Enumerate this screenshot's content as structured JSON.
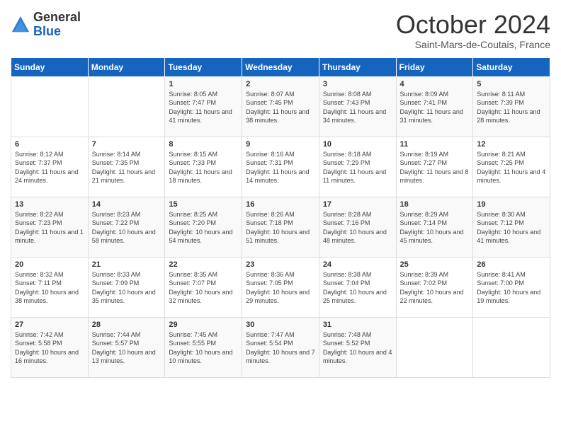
{
  "header": {
    "logo_general": "General",
    "logo_blue": "Blue",
    "month_title": "October 2024",
    "subtitle": "Saint-Mars-de-Coutais, France"
  },
  "days_of_week": [
    "Sunday",
    "Monday",
    "Tuesday",
    "Wednesday",
    "Thursday",
    "Friday",
    "Saturday"
  ],
  "weeks": [
    [
      {
        "day": "",
        "info": ""
      },
      {
        "day": "",
        "info": ""
      },
      {
        "day": "1",
        "info": "Sunrise: 8:05 AM\nSunset: 7:47 PM\nDaylight: 11 hours and 41 minutes."
      },
      {
        "day": "2",
        "info": "Sunrise: 8:07 AM\nSunset: 7:45 PM\nDaylight: 11 hours and 38 minutes."
      },
      {
        "day": "3",
        "info": "Sunrise: 8:08 AM\nSunset: 7:43 PM\nDaylight: 11 hours and 34 minutes."
      },
      {
        "day": "4",
        "info": "Sunrise: 8:09 AM\nSunset: 7:41 PM\nDaylight: 11 hours and 31 minutes."
      },
      {
        "day": "5",
        "info": "Sunrise: 8:11 AM\nSunset: 7:39 PM\nDaylight: 11 hours and 28 minutes."
      }
    ],
    [
      {
        "day": "6",
        "info": "Sunrise: 8:12 AM\nSunset: 7:37 PM\nDaylight: 11 hours and 24 minutes."
      },
      {
        "day": "7",
        "info": "Sunrise: 8:14 AM\nSunset: 7:35 PM\nDaylight: 11 hours and 21 minutes."
      },
      {
        "day": "8",
        "info": "Sunrise: 8:15 AM\nSunset: 7:33 PM\nDaylight: 11 hours and 18 minutes."
      },
      {
        "day": "9",
        "info": "Sunrise: 8:16 AM\nSunset: 7:31 PM\nDaylight: 11 hours and 14 minutes."
      },
      {
        "day": "10",
        "info": "Sunrise: 8:18 AM\nSunset: 7:29 PM\nDaylight: 11 hours and 11 minutes."
      },
      {
        "day": "11",
        "info": "Sunrise: 8:19 AM\nSunset: 7:27 PM\nDaylight: 11 hours and 8 minutes."
      },
      {
        "day": "12",
        "info": "Sunrise: 8:21 AM\nSunset: 7:25 PM\nDaylight: 11 hours and 4 minutes."
      }
    ],
    [
      {
        "day": "13",
        "info": "Sunrise: 8:22 AM\nSunset: 7:23 PM\nDaylight: 11 hours and 1 minute."
      },
      {
        "day": "14",
        "info": "Sunrise: 8:23 AM\nSunset: 7:22 PM\nDaylight: 10 hours and 58 minutes."
      },
      {
        "day": "15",
        "info": "Sunrise: 8:25 AM\nSunset: 7:20 PM\nDaylight: 10 hours and 54 minutes."
      },
      {
        "day": "16",
        "info": "Sunrise: 8:26 AM\nSunset: 7:18 PM\nDaylight: 10 hours and 51 minutes."
      },
      {
        "day": "17",
        "info": "Sunrise: 8:28 AM\nSunset: 7:16 PM\nDaylight: 10 hours and 48 minutes."
      },
      {
        "day": "18",
        "info": "Sunrise: 8:29 AM\nSunset: 7:14 PM\nDaylight: 10 hours and 45 minutes."
      },
      {
        "day": "19",
        "info": "Sunrise: 8:30 AM\nSunset: 7:12 PM\nDaylight: 10 hours and 41 minutes."
      }
    ],
    [
      {
        "day": "20",
        "info": "Sunrise: 8:32 AM\nSunset: 7:11 PM\nDaylight: 10 hours and 38 minutes."
      },
      {
        "day": "21",
        "info": "Sunrise: 8:33 AM\nSunset: 7:09 PM\nDaylight: 10 hours and 35 minutes."
      },
      {
        "day": "22",
        "info": "Sunrise: 8:35 AM\nSunset: 7:07 PM\nDaylight: 10 hours and 32 minutes."
      },
      {
        "day": "23",
        "info": "Sunrise: 8:36 AM\nSunset: 7:05 PM\nDaylight: 10 hours and 29 minutes."
      },
      {
        "day": "24",
        "info": "Sunrise: 8:38 AM\nSunset: 7:04 PM\nDaylight: 10 hours and 25 minutes."
      },
      {
        "day": "25",
        "info": "Sunrise: 8:39 AM\nSunset: 7:02 PM\nDaylight: 10 hours and 22 minutes."
      },
      {
        "day": "26",
        "info": "Sunrise: 8:41 AM\nSunset: 7:00 PM\nDaylight: 10 hours and 19 minutes."
      }
    ],
    [
      {
        "day": "27",
        "info": "Sunrise: 7:42 AM\nSunset: 5:58 PM\nDaylight: 10 hours and 16 minutes."
      },
      {
        "day": "28",
        "info": "Sunrise: 7:44 AM\nSunset: 5:57 PM\nDaylight: 10 hours and 13 minutes."
      },
      {
        "day": "29",
        "info": "Sunrise: 7:45 AM\nSunset: 5:55 PM\nDaylight: 10 hours and 10 minutes."
      },
      {
        "day": "30",
        "info": "Sunrise: 7:47 AM\nSunset: 5:54 PM\nDaylight: 10 hours and 7 minutes."
      },
      {
        "day": "31",
        "info": "Sunrise: 7:48 AM\nSunset: 5:52 PM\nDaylight: 10 hours and 4 minutes."
      },
      {
        "day": "",
        "info": ""
      },
      {
        "day": "",
        "info": ""
      }
    ]
  ]
}
